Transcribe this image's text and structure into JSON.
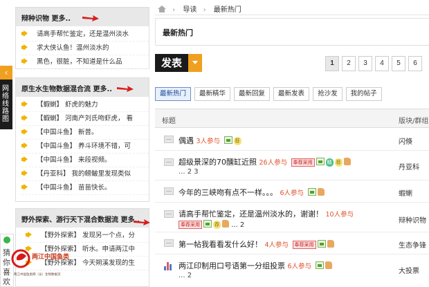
{
  "sidebar_nav": {
    "arrow": "‹",
    "label": "网络线路图"
  },
  "panels": [
    {
      "title": "辩种识物",
      "more": "更多..",
      "items": [
        "请高手帮忙鉴定，还是温州淡水",
        "求大侠认鱼！温州淡水的",
        "黑色，很脏，不知道是什么品"
      ]
    },
    {
      "title": "原生水生物数据混合流",
      "more": "更多..",
      "items": [
        "【蝦蝲】 虾虎的魅力",
        "【蝦蝲】 河南产刘氏吻虾虎， 看",
        "【中国斗鱼】 新普。",
        "【中国斗鱼】 养斗环境不错，可",
        "【中国斗鱼】 来段视频。",
        "【丹亚科】 我的鳑鲏里发现类似",
        "【中国斗鱼】 苗苗快长。"
      ]
    },
    {
      "title": "野外探索、游行天下混合数据流",
      "more": "更多..",
      "items": [
        "【野外探索】 发现另一个点，分",
        "【野外探索】 听水。申请两江中",
        "【野外探索】 今天朔溪发现的生"
      ]
    }
  ],
  "breadcrumb": {
    "items": [
      "导读",
      "最新热门"
    ],
    "sep": "›"
  },
  "title_box": "最新热门",
  "post_button": "发表",
  "pager": [
    "1",
    "2",
    "3",
    "4",
    "5",
    "6"
  ],
  "tabs": [
    "最新热门",
    "最新精华",
    "最新回复",
    "最新发表",
    "抢沙发",
    "我的帖子"
  ],
  "table": {
    "col_title": "标题",
    "col_forum": "版块/群组",
    "rows": [
      {
        "title": "偶遇",
        "count": "3人参与",
        "extra": "",
        "forum": "闪倏"
      },
      {
        "title": "超级景深的70醺缸近照",
        "count": "26人参与",
        "extra": "... 2 3",
        "forum": "丹亚科"
      },
      {
        "title": "今年的三峡吻有点不一样。。。",
        "count": "6人参与",
        "extra": "",
        "forum": "蝦蝲"
      },
      {
        "title": "请高手帮忙鉴定，还是温州淡水的，谢谢！",
        "count": "10人参与",
        "extra": "... 2",
        "forum": "辩种识物"
      },
      {
        "title": "第一帖我看看发什么好！",
        "count": "4人参与",
        "extra": "",
        "forum": "生态争锋"
      },
      {
        "title": "两江印制用口号语第一分组投票",
        "count": "6人参与",
        "extra": "... 2",
        "forum": "大投票"
      }
    ],
    "badges": {
      "new": "奉荐采用",
      "yellow": "荐",
      "green": "精"
    }
  },
  "float_widget": {
    "text": "猜你喜欢"
  },
  "watermark": {
    "line1": "两江中国鱼类",
    "line2": "两江中国鱼类网（淡）生物数据流"
  },
  "colors": {
    "accent": "#f0a020",
    "count_red": "#e0522a",
    "tab_active": "#1a4a9a"
  }
}
